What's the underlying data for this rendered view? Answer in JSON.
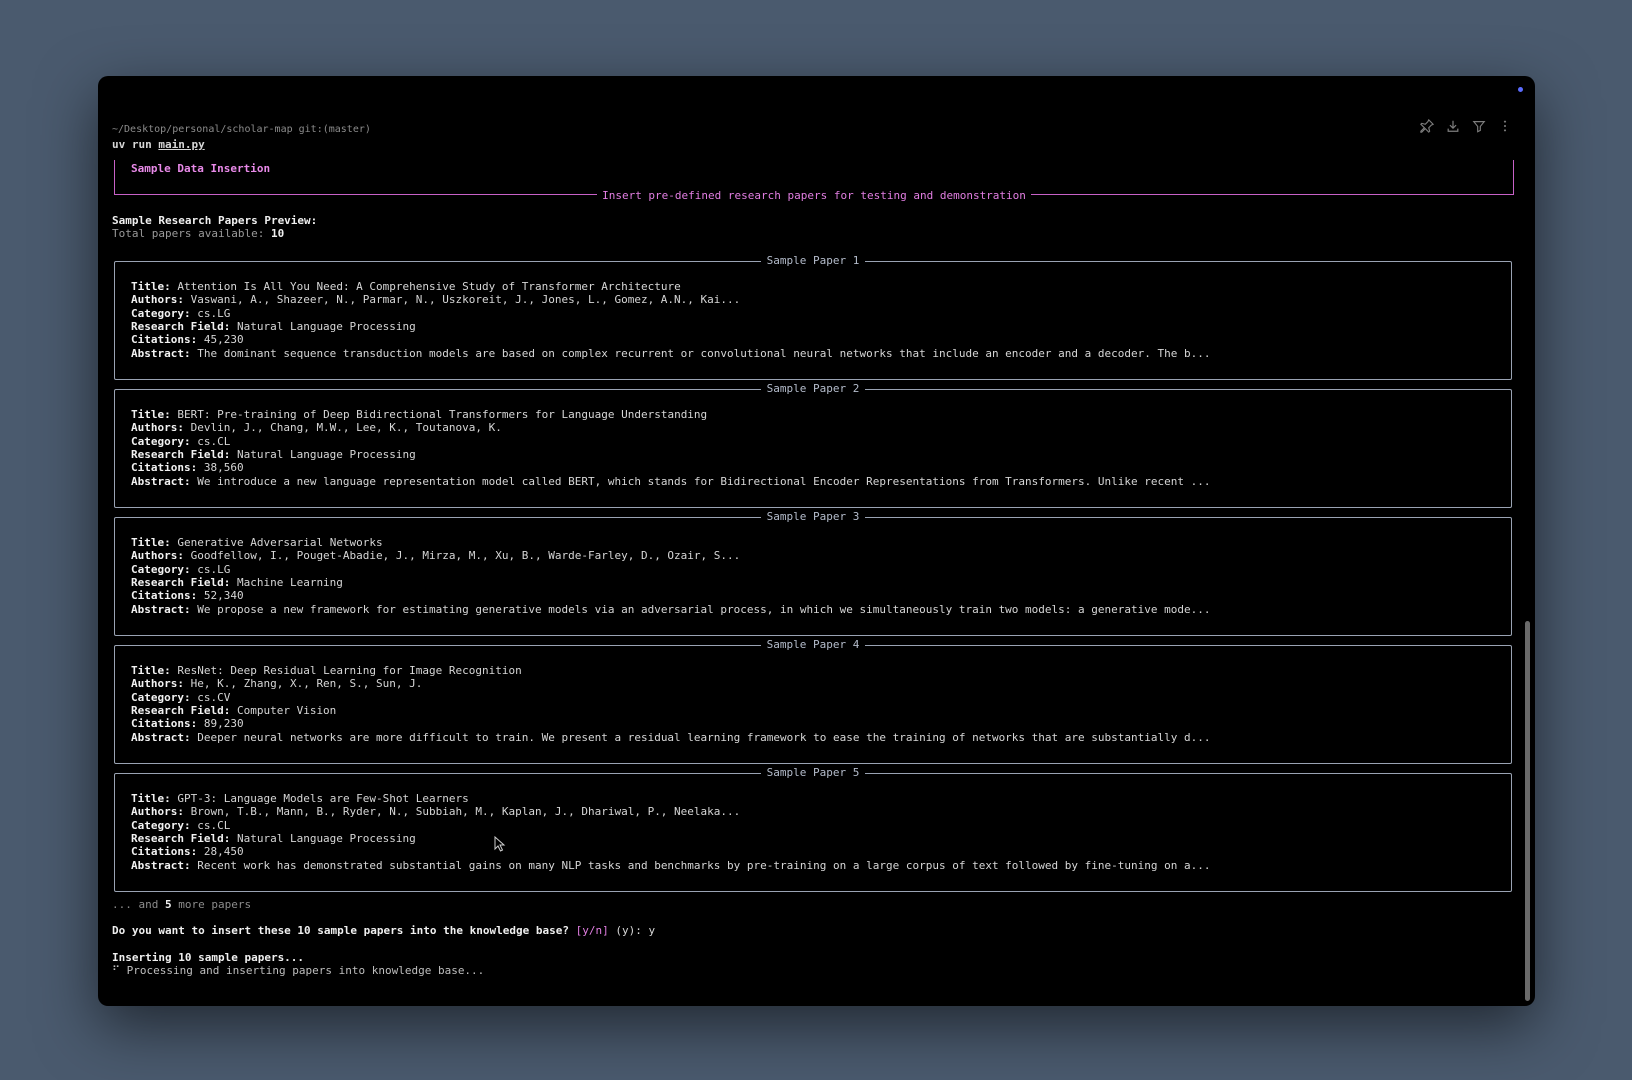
{
  "prompt": {
    "path": "~/Desktop/personal/scholar-map git:(master)",
    "cmd_prefix": "uv run ",
    "cmd_file": "main.py"
  },
  "toolbar": {
    "icons": [
      "pin-icon",
      "download-icon",
      "filter-icon",
      "more-icon"
    ]
  },
  "header": {
    "title": "Sample Data Insertion",
    "subtitle": "Insert pre-defined research papers for testing and demonstration"
  },
  "preview": {
    "heading": "Sample Research Papers Preview:",
    "total_label": "Total papers available: ",
    "total_value": "10"
  },
  "labels": {
    "title": "Title:",
    "authors": "Authors:",
    "category": "Category:",
    "field": "Research Field:",
    "citations": "Citations:",
    "abstract": "Abstract:"
  },
  "papers": [
    {
      "caption": "Sample Paper 1",
      "title": "Attention Is All You Need: A Comprehensive Study of Transformer Architecture",
      "authors": "Vaswani, A., Shazeer, N., Parmar, N., Uszkoreit, J., Jones, L., Gomez, A.N., Kai...",
      "category": "cs.LG",
      "field": "Natural Language Processing",
      "citations": "45,230",
      "abstract": "The dominant sequence transduction models are based on complex recurrent or convolutional neural networks that include an encoder and a decoder. The b..."
    },
    {
      "caption": "Sample Paper 2",
      "title": "BERT: Pre-training of Deep Bidirectional Transformers for Language Understanding",
      "authors": "Devlin, J., Chang, M.W., Lee, K., Toutanova, K.",
      "category": "cs.CL",
      "field": "Natural Language Processing",
      "citations": "38,560",
      "abstract": "We introduce a new language representation model called BERT, which stands for Bidirectional Encoder Representations from Transformers. Unlike recent ..."
    },
    {
      "caption": "Sample Paper 3",
      "title": "Generative Adversarial Networks",
      "authors": "Goodfellow, I., Pouget-Abadie, J., Mirza, M., Xu, B., Warde-Farley, D., Ozair, S...",
      "category": "cs.LG",
      "field": "Machine Learning",
      "citations": "52,340",
      "abstract": "We propose a new framework for estimating generative models via an adversarial process, in which we simultaneously train two models: a generative mode..."
    },
    {
      "caption": "Sample Paper 4",
      "title": "ResNet: Deep Residual Learning for Image Recognition",
      "authors": "He, K., Zhang, X., Ren, S., Sun, J.",
      "category": "cs.CV",
      "field": "Computer Vision",
      "citations": "89,230",
      "abstract": "Deeper neural networks are more difficult to train. We present a residual learning framework to ease the training of networks that are substantially d..."
    },
    {
      "caption": "Sample Paper 5",
      "title": "GPT-3: Language Models are Few-Shot Learners",
      "authors": "Brown, T.B., Mann, B., Ryder, N., Subbiah, M., Kaplan, J., Dhariwal, P., Neelaka...",
      "category": "cs.CL",
      "field": "Natural Language Processing",
      "citations": "28,450",
      "abstract": "Recent work has demonstrated substantial gains on many NLP tasks and benchmarks by pre-training on a large corpus of text followed by fine-tuning on a..."
    }
  ],
  "more": {
    "prefix": "... and ",
    "count": "5",
    "suffix": " more papers"
  },
  "question": {
    "text": "Do you want to insert these 10 sample papers into the knowledge base? ",
    "options": "[y/n]",
    "default": " (y): ",
    "answer": "y"
  },
  "inserting": "Inserting 10 sample papers...",
  "processing": {
    "spinner": "⠋",
    "text": " Processing and inserting papers into knowledge base..."
  }
}
